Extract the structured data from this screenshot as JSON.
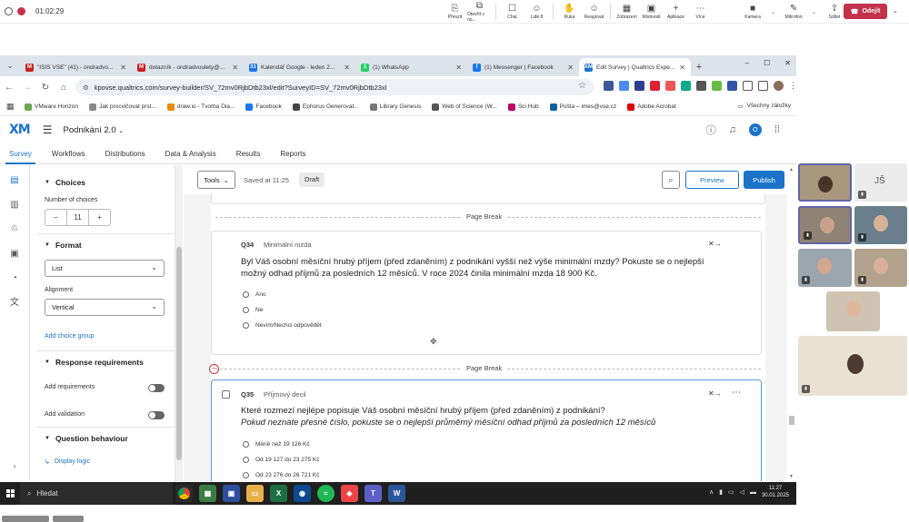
{
  "teams": {
    "timer": "01:02:29",
    "tools": [
      {
        "icon": "prevzit-icon",
        "label": "Převzít",
        "glyph": "⎘"
      },
      {
        "icon": "open-in-icon",
        "label": "Otevřít v no...",
        "glyph": "⧉"
      },
      {
        "icon": "chat-icon",
        "label": "Chat",
        "glyph": "☐"
      },
      {
        "icon": "people-icon",
        "label": "Lidé",
        "glyph": "☺",
        "count": "8"
      },
      {
        "icon": "raise-hand-icon",
        "label": "Ruka",
        "glyph": "✋"
      },
      {
        "icon": "react-icon",
        "label": "Reagovat",
        "glyph": "☺"
      },
      {
        "icon": "view-icon",
        "label": "Zobrazení",
        "glyph": "▦"
      },
      {
        "icon": "rooms-icon",
        "label": "Místnosti",
        "glyph": "▣"
      },
      {
        "icon": "apps-icon",
        "label": "Aplikace",
        "glyph": "+"
      },
      {
        "icon": "more-icon",
        "label": "Více",
        "glyph": "⋯"
      }
    ],
    "camera": "Kamera",
    "mic": "Mikrofon",
    "share": "Sdílet",
    "leave": "Odejít"
  },
  "browser": {
    "tabs": [
      {
        "title": "\"ISIS VŠE\" (41) - ondradvo...",
        "color": "#c5221f",
        "glyph": "M"
      },
      {
        "title": "dotazník - ondradvoulety@...",
        "color": "#c5221f",
        "glyph": "M"
      },
      {
        "title": "Kalendář Google - leden 2...",
        "color": "#1a73e8",
        "glyph": "31"
      },
      {
        "title": "(1) WhatsApp",
        "color": "#25d366",
        "glyph": "1"
      },
      {
        "title": "(1) Messenger | Facebook",
        "color": "#1877f2",
        "glyph": "f"
      },
      {
        "title": "Edit Survey | Qualtrics Expe...",
        "color": "#1a73c9",
        "glyph": "XM"
      }
    ],
    "url": "kpovse.qualtrics.com/survey-builder/SV_72mv0RjbDtb23xl/edit?SurveyID=SV_72mv0RjbDtb23xl",
    "bookmarks": [
      {
        "label": "VMware Horizon",
        "color": "#6aa84f"
      },
      {
        "label": "Jak procvičovat prst...",
        "color": "#888"
      },
      {
        "label": "draw.io - Tvorba Dia...",
        "color": "#f08705"
      },
      {
        "label": "Facebook",
        "color": "#1877f2"
      },
      {
        "label": "Ephorus Generovat...",
        "color": "#444"
      },
      {
        "label": "Library Genesis",
        "color": "#777"
      },
      {
        "label": "Web of Science (W...",
        "color": "#555"
      },
      {
        "label": "Sci Hub",
        "color": "#b06"
      },
      {
        "label": "Pošta – imes@vse.cz",
        "color": "#0a64a4"
      },
      {
        "label": "Adobe Acrobat",
        "color": "#d00"
      }
    ],
    "all_bookmarks": "Všechny záložky"
  },
  "qualtrics": {
    "logo": "XM",
    "project": "Podnikání 2.0",
    "user_initial": "O",
    "nav": [
      "Survey",
      "Workflows",
      "Distributions",
      "Data & Analysis",
      "Results",
      "Reports"
    ],
    "panel": {
      "choices_title": "Choices",
      "num_choices_label": "Number of choices",
      "num_choices_value": "11",
      "format_title": "Format",
      "format_value": "List",
      "alignment_label": "Alignment",
      "alignment_value": "Vertical",
      "add_choice_group": "Add choice group",
      "response_title": "Response requirements",
      "add_requirements": "Add requirements",
      "add_validation": "Add validation",
      "behaviour_title": "Question behaviour",
      "display_logic": "Display logic"
    },
    "toolbar": {
      "tools": "Tools",
      "saved": "Saved at 11:25",
      "draft": "Draft",
      "preview": "Preview",
      "publish": "Publish"
    },
    "page_break": "Page Break",
    "q34": {
      "id": "Q34",
      "name": "Minimální mzda",
      "text": "Byl Váš osobní měsíční hrubý příjem (před zdaněním) z podnikání vyšší než výše minimální mzdy? Pokuste se o nejlepší možný odhad příjmů za posledních 12 měsíců. V roce 2024 činila minimální mzda 18 900 Kč.",
      "options": [
        "Ano",
        "Ne",
        "Nevím/Nechci odpovědět"
      ]
    },
    "q35": {
      "id": "Q35",
      "name": "Příjmový decil",
      "text": "Které rozmezí nejlépe popisuje Váš osobní měsíční hrubý příjem (před zdaněním) z podnikání?",
      "text_italic": "Pokud neznáte přesné číslo, pokuste se o nejlepší průměrný měsíční odhad příjmů za posledních 12 měsíců",
      "options": [
        "Méně než 19 126 Kč",
        "Od 19 127 do 23 275 Kč",
        "Od 23 276 do 26 721 Kč"
      ]
    }
  },
  "taskbar": {
    "search": "Hledat",
    "time": "11:27",
    "date": "30.01.2025"
  },
  "participants": {
    "initials_tile": "JŠ"
  }
}
